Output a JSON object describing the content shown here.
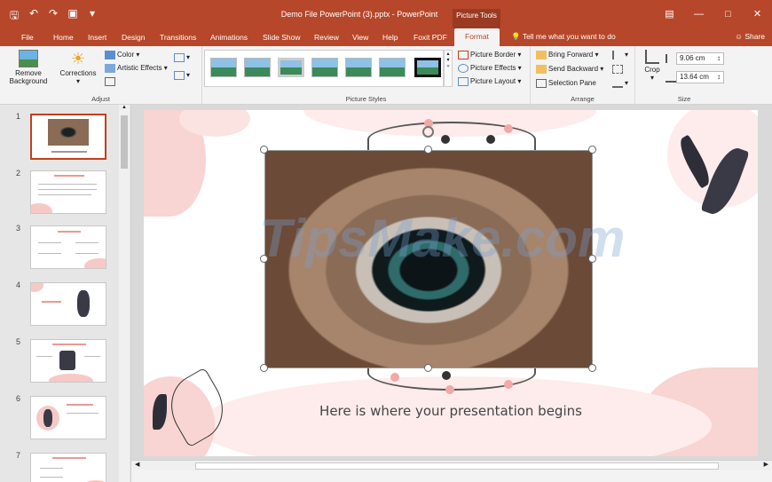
{
  "window": {
    "title": "Demo File PowerPoint (3).pptx  -  PowerPoint",
    "contextual_tab_group": "Picture Tools",
    "quick_access_icons": [
      "save-icon",
      "undo-icon",
      "redo-icon",
      "present-icon",
      "customize-icon"
    ],
    "controls": [
      "ribbon-display-icon",
      "minimize-icon",
      "maximize-icon",
      "close-icon"
    ]
  },
  "tabs": [
    {
      "label": "File"
    },
    {
      "label": "Home"
    },
    {
      "label": "Insert"
    },
    {
      "label": "Design"
    },
    {
      "label": "Transitions"
    },
    {
      "label": "Animations"
    },
    {
      "label": "Slide Show"
    },
    {
      "label": "Review"
    },
    {
      "label": "View"
    },
    {
      "label": "Help"
    },
    {
      "label": "Foxit PDF"
    },
    {
      "label": "Format",
      "active": true
    }
  ],
  "tell_me": "Tell me what you want to do",
  "share": "Share",
  "ribbon": {
    "adjust": {
      "label": "Adjust",
      "remove_background": "Remove Background",
      "corrections": "Corrections",
      "color": "Color",
      "artistic_effects": "Artistic Effects"
    },
    "picture_styles": {
      "label": "Picture Styles",
      "picture_border": "Picture Border",
      "picture_effects": "Picture Effects",
      "picture_layout": "Picture Layout"
    },
    "arrange": {
      "label": "Arrange",
      "bring_forward": "Bring Forward",
      "send_backward": "Send Backward",
      "selection_pane": "Selection Pane"
    },
    "size": {
      "label": "Size",
      "crop": "Crop",
      "height": "9.06 cm",
      "width": "13.64 cm"
    }
  },
  "thumbnails": [
    {
      "number": "1",
      "active": true
    },
    {
      "number": "2"
    },
    {
      "number": "3"
    },
    {
      "number": "4"
    },
    {
      "number": "5"
    },
    {
      "number": "6"
    },
    {
      "number": "7"
    }
  ],
  "slide": {
    "caption": "Here is where your presentation begins",
    "watermark": "TipsMake.com"
  },
  "colors": {
    "accent": "#b7472a",
    "slide_pink": "#f8d4d2",
    "dark_leaf": "#3a3a47"
  }
}
